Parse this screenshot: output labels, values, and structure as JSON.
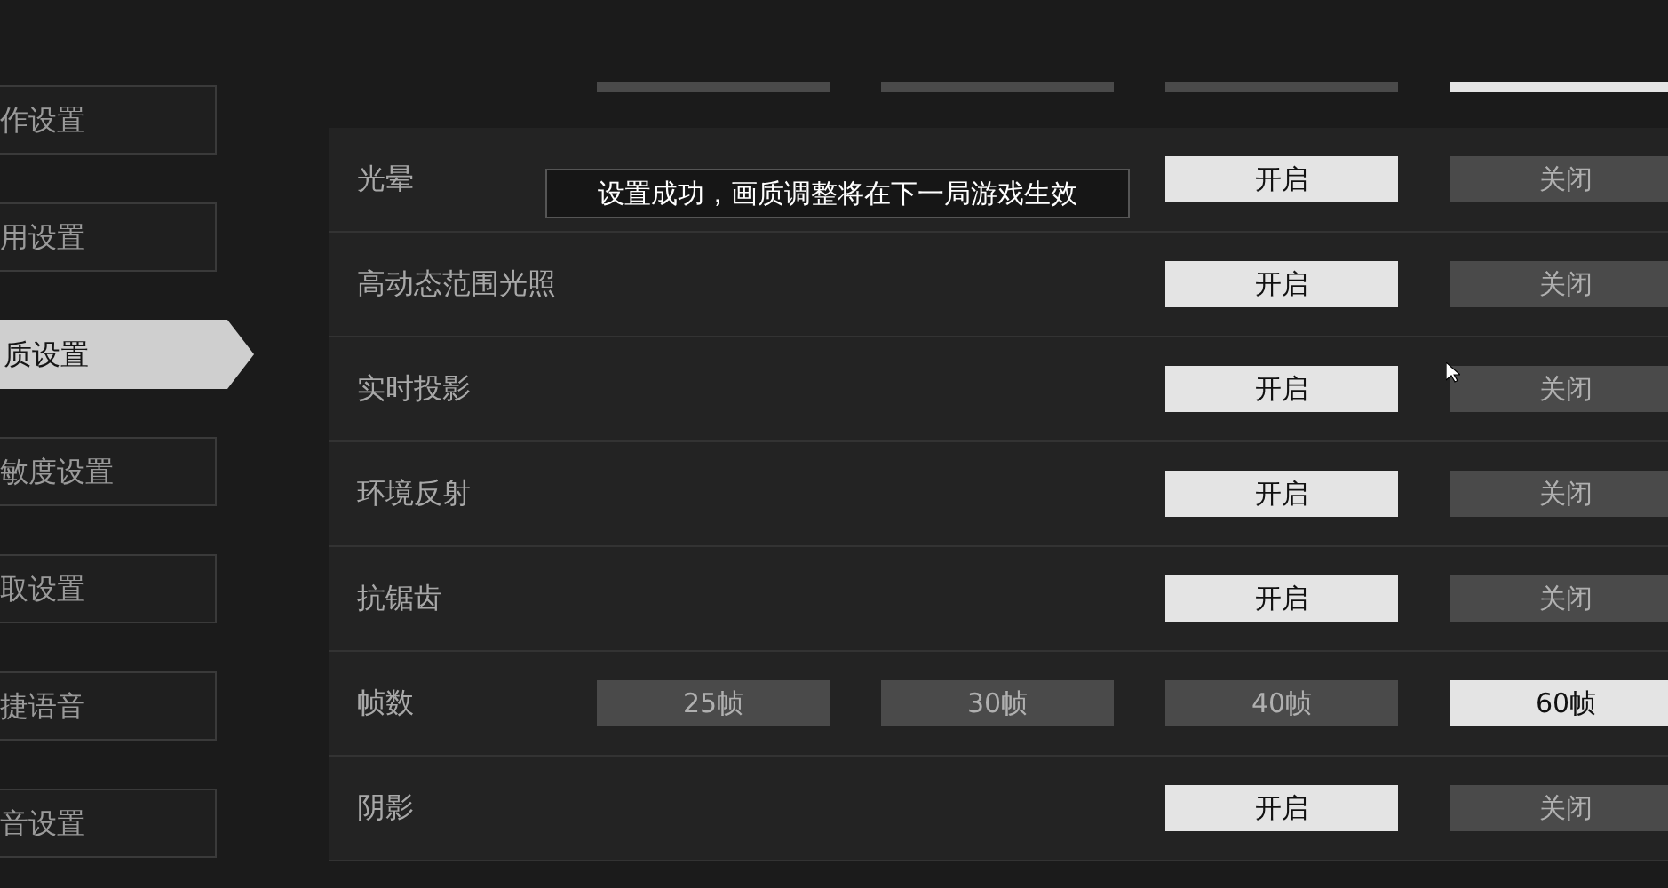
{
  "sidebar": {
    "items": [
      {
        "label": "作设置",
        "selected": false
      },
      {
        "label": "用设置",
        "selected": false
      },
      {
        "label": "质设置",
        "selected": true
      },
      {
        "label": "敏度设置",
        "selected": false
      },
      {
        "label": "取设置",
        "selected": false
      },
      {
        "label": "捷语音",
        "selected": false
      },
      {
        "label": "音设置",
        "selected": false
      }
    ]
  },
  "settings": {
    "top_row_options": [
      {
        "selected": false
      },
      {
        "selected": false
      },
      {
        "selected": false
      },
      {
        "selected": true
      }
    ],
    "rows": [
      {
        "label": "光晕",
        "kind": "toggle",
        "options": [
          {
            "label": "开启",
            "selected": true
          },
          {
            "label": "关闭",
            "selected": false
          }
        ]
      },
      {
        "label": "高动态范围光照",
        "kind": "toggle",
        "options": [
          {
            "label": "开启",
            "selected": true
          },
          {
            "label": "关闭",
            "selected": false
          }
        ]
      },
      {
        "label": "实时投影",
        "kind": "toggle",
        "options": [
          {
            "label": "开启",
            "selected": true
          },
          {
            "label": "关闭",
            "selected": false
          }
        ]
      },
      {
        "label": "环境反射",
        "kind": "toggle",
        "options": [
          {
            "label": "开启",
            "selected": true
          },
          {
            "label": "关闭",
            "selected": false
          }
        ]
      },
      {
        "label": "抗锯齿",
        "kind": "toggle",
        "options": [
          {
            "label": "开启",
            "selected": true
          },
          {
            "label": "关闭",
            "selected": false
          }
        ]
      },
      {
        "label": "帧数",
        "kind": "choice",
        "options": [
          {
            "label": "25帧",
            "selected": false
          },
          {
            "label": "30帧",
            "selected": false
          },
          {
            "label": "40帧",
            "selected": false
          },
          {
            "label": "60帧",
            "selected": true
          }
        ]
      },
      {
        "label": "阴影",
        "kind": "toggle",
        "options": [
          {
            "label": "开启",
            "selected": true
          },
          {
            "label": "关闭",
            "selected": false
          }
        ]
      }
    ]
  },
  "toast": {
    "message": "设置成功，画质调整将在下一局游戏生效"
  }
}
